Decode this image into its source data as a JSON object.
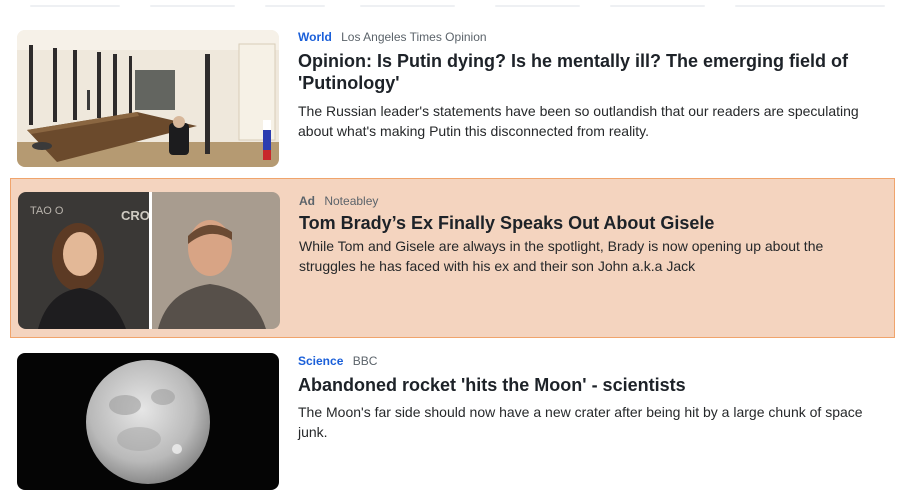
{
  "articles": [
    {
      "category": "World",
      "source": "Los Angeles Times Opinion",
      "title": "Opinion: Is Putin dying? Is he mentally ill? The emerging field of 'Putinology'",
      "summary": "The Russian leader's statements have been so outlandish that our readers are speculating about what's making Putin this disconnected from reality.",
      "image": "putin-at-long-table"
    },
    {
      "category": "Ad",
      "source": "Noteabley",
      "title": "Tom Brady’s Ex Finally Speaks Out About Gisele",
      "summary": "While Tom and Gisele are always in the spotlight, Brady is now opening up about the struggles he has faced with his ex and their son John a.k.a Jack",
      "image": "two-portraits",
      "image_text": "TAO O",
      "image_text2": "CROW"
    },
    {
      "category": "Science",
      "source": "BBC",
      "title": "Abandoned rocket 'hits the Moon' - scientists",
      "summary": "The Moon's far side should now have a new crater after being hit by a large chunk of space junk.",
      "image": "full-moon"
    }
  ],
  "colors": {
    "category_link": "#1a5fd9",
    "ad_background": "#f4d4bf",
    "ad_border": "#f0a46c"
  }
}
